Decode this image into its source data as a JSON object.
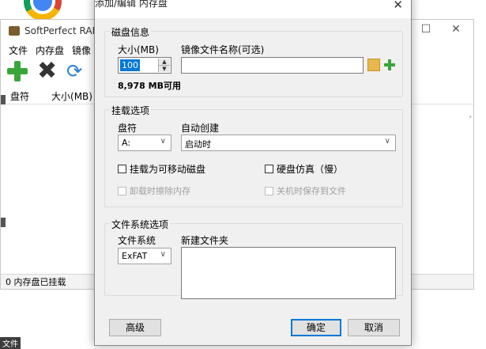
{
  "main_window": {
    "title": "SoftPerfect RAM",
    "menu": [
      "文件",
      "内存盘",
      "镜像"
    ],
    "columns": [
      "盘符",
      "大小(MB)"
    ],
    "status": "0 内存盘已挂载"
  },
  "taskbar_tag": "文件",
  "dialog": {
    "title": "添加/编辑 内存盘",
    "disk_info": {
      "group_title": "磁盘信息",
      "size_label": "大小(MB)",
      "size_value": "100",
      "image_label": "镜像文件名称(可选)",
      "image_value": "",
      "available": "8,978 MB可用"
    },
    "mount": {
      "group_title": "挂载选项",
      "drive_label": "盘符",
      "drive_value": "A:",
      "autocreate_label": "自动创建",
      "autocreate_value": "启动时",
      "removable_label": "挂载为可移动磁盘",
      "hdd_emulation_label": "硬盘仿真（慢）",
      "clear_mem_label": "卸载时擦除内存",
      "save_on_shutdown_label": "关机时保存到文件"
    },
    "filesystem": {
      "group_title": "文件系统选项",
      "fs_label": "文件系统",
      "fs_value": "ExFAT",
      "new_folder_label": "新建文件夹"
    },
    "buttons": {
      "advanced": "高级",
      "ok": "确定",
      "cancel": "取消"
    }
  }
}
